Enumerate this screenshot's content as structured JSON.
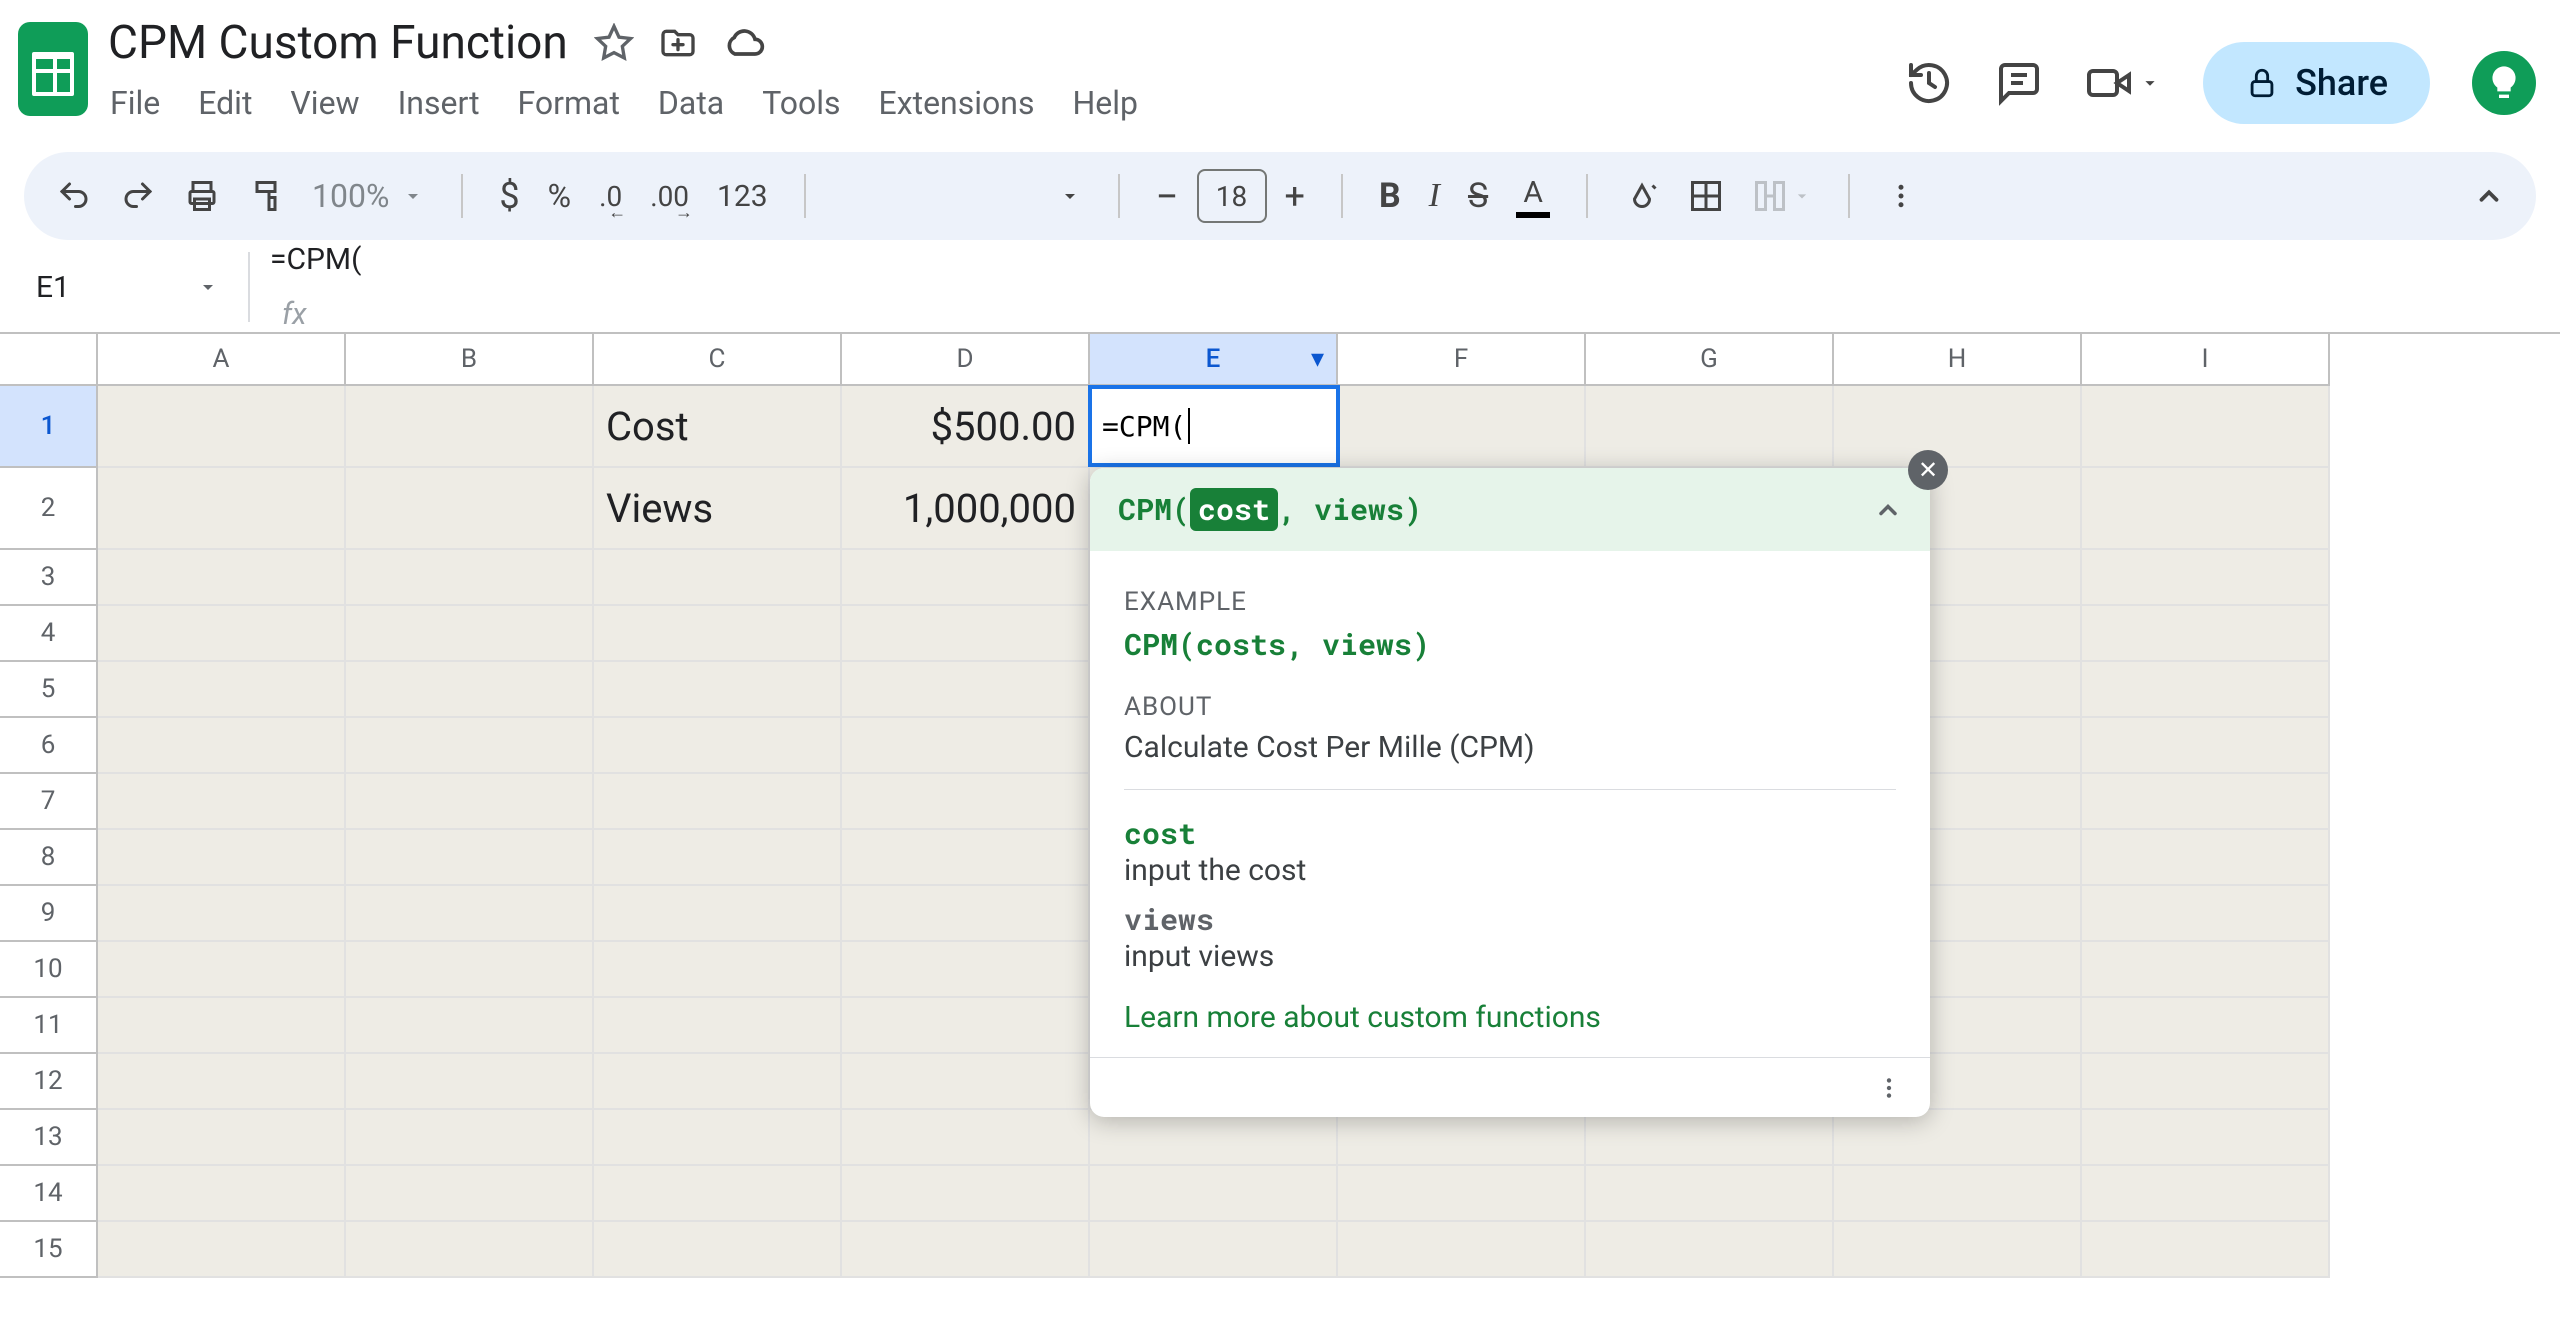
{
  "document": {
    "title": "CPM Custom Function"
  },
  "menubar": [
    "File",
    "Edit",
    "View",
    "Insert",
    "Format",
    "Data",
    "Tools",
    "Extensions",
    "Help"
  ],
  "share_label": "Share",
  "toolbar": {
    "zoom": "100%",
    "currency": "$",
    "percent": "%",
    "dec_dec": ".0",
    "inc_dec": ".00",
    "num_fmt": "123",
    "font_size": "18"
  },
  "namebox": "E1",
  "formula_bar": "=CPM(",
  "columns": [
    "A",
    "B",
    "C",
    "D",
    "E",
    "F",
    "G",
    "H",
    "I"
  ],
  "selected_col": "E",
  "rows": [
    "1",
    "2",
    "3",
    "4",
    "5",
    "6",
    "7",
    "8",
    "9",
    "10",
    "11",
    "12",
    "13",
    "14",
    "15"
  ],
  "selected_row": "1",
  "cells": {
    "C1": "Cost",
    "D1": "$500.00",
    "C2": "Views",
    "D2": "1,000,000"
  },
  "active_cell": {
    "value": "=CPM("
  },
  "tooltip": {
    "signature_pre": "CPM(",
    "signature_arg": "cost",
    "signature_post": ", views)",
    "example_label": "EXAMPLE",
    "example": "CPM(costs, views)",
    "about_label": "ABOUT",
    "about": "Calculate Cost Per Mille (CPM)",
    "param1_name": "cost",
    "param1_desc": "input the cost",
    "param2_name": "views",
    "param2_desc": "input views",
    "learn_more": "Learn more about custom functions"
  }
}
